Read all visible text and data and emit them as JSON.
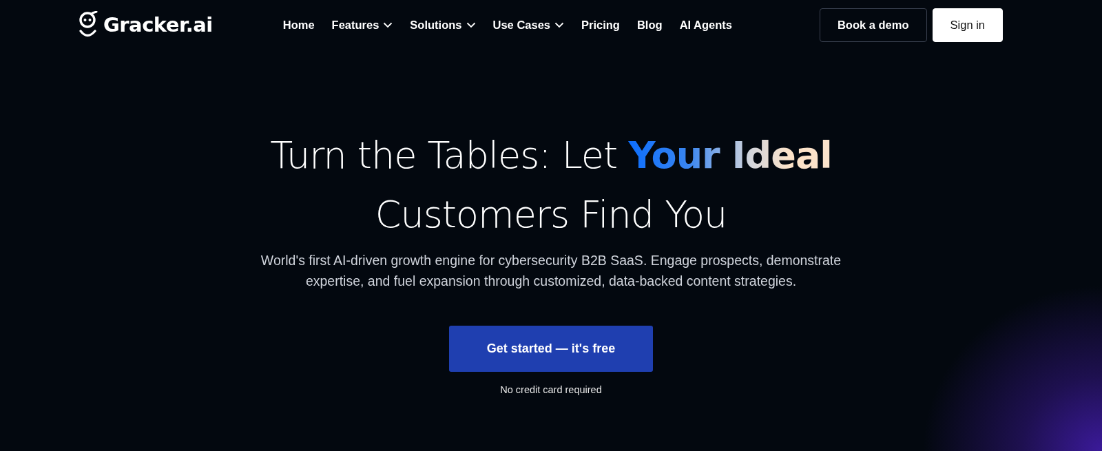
{
  "logo": {
    "text": "Gracker.ai"
  },
  "nav": [
    {
      "label": "Home",
      "kind": "link"
    },
    {
      "label": "Features",
      "kind": "dropdown"
    },
    {
      "label": "Solutions",
      "kind": "dropdown"
    },
    {
      "label": "Use Cases",
      "kind": "dropdown"
    },
    {
      "label": "Pricing",
      "kind": "link"
    },
    {
      "label": "Blog",
      "kind": "link"
    },
    {
      "label": "AI Agents",
      "kind": "link"
    }
  ],
  "actions": [
    {
      "label": "Book a demo",
      "kind": "outline"
    },
    {
      "label": "Sign in",
      "kind": "solid"
    }
  ],
  "hero": {
    "headline_line_1": "Turn the Tables: Let **Your Ideal**",
    "headline_line_2": "Customers Find You",
    "subtitle": "World's first AI-driven growth engine for cybersecurity B2B SaaS. Engage prospects, demonstrate expertise, and fuel expansion through customized, data-backed content strategies.",
    "cta": "Get started — it's free",
    "note": "No credit card required"
  }
}
